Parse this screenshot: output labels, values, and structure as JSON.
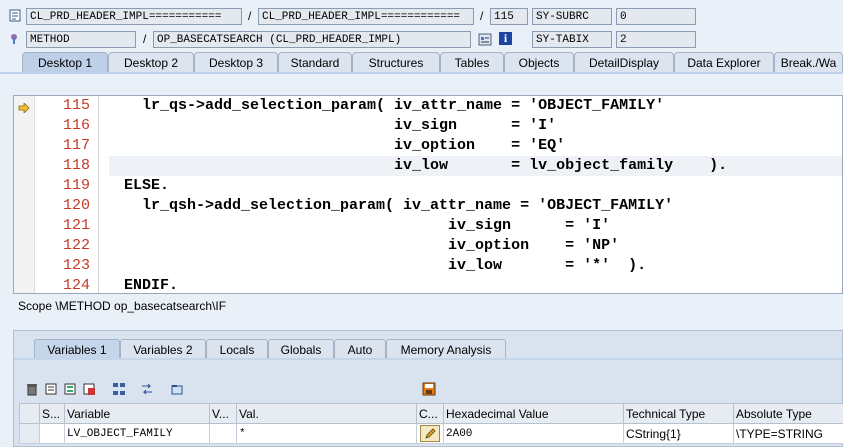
{
  "header": {
    "row1": {
      "program": "CL_PRD_HEADER_IMPL===========",
      "include": "CL_PRD_HEADER_IMPL============",
      "line": "115",
      "sysfield_name": "SY-SUBRC",
      "sysfield_value": "0"
    },
    "row2": {
      "event_type": "METHOD",
      "event": "OP_BASECATSEARCH (CL_PRD_HEADER_IMPL)",
      "sysfield_name": "SY-TABIX",
      "sysfield_value": "2"
    },
    "separator": "/"
  },
  "desktop_tabs": [
    {
      "label": "Desktop 1"
    },
    {
      "label": "Desktop 2"
    },
    {
      "label": "Desktop 3"
    },
    {
      "label": "Standard"
    },
    {
      "label": "Structures"
    },
    {
      "label": "Tables"
    },
    {
      "label": "Objects"
    },
    {
      "label": "DetailDisplay"
    },
    {
      "label": "Data Explorer"
    },
    {
      "label": "Break./Wa"
    }
  ],
  "code": {
    "current_line": "115",
    "lines": [
      {
        "num": "115",
        "text": "  lr_qs->add_selection_param( iv_attr_name = 'OBJECT_FAMILY'"
      },
      {
        "num": "116",
        "text": "                              iv_sign      = 'I'"
      },
      {
        "num": "117",
        "text": "                              iv_option    = 'EQ'"
      },
      {
        "num": "118",
        "text": "                              iv_low       = lv_object_family    )."
      },
      {
        "num": "119",
        "text": "ELSE."
      },
      {
        "num": "120",
        "text": "  lr_qsh->add_selection_param( iv_attr_name = 'OBJECT_FAMILY'"
      },
      {
        "num": "121",
        "text": "                                    iv_sign      = 'I'"
      },
      {
        "num": "122",
        "text": "                                    iv_option    = 'NP'"
      },
      {
        "num": "123",
        "text": "                                    iv_low       = '*'  )."
      },
      {
        "num": "124",
        "text": "ENDIF."
      }
    ]
  },
  "scope": "Scope \\METHOD op_basecatsearch\\IF",
  "variable_tabs": [
    {
      "label": "Variables 1"
    },
    {
      "label": "Variables 2"
    },
    {
      "label": "Locals"
    },
    {
      "label": "Globals"
    },
    {
      "label": "Auto"
    },
    {
      "label": "Memory Analysis"
    }
  ],
  "variables_table": {
    "columns": [
      "S...",
      "Variable",
      "V...",
      "Val.",
      "C...",
      "Hexadecimal Value",
      "Technical Type",
      "Absolute Type"
    ],
    "rows": [
      {
        "variable": "LV_OBJECT_FAMILY",
        "value": "*",
        "hex": "2A00",
        "technical_type": "CString{1}",
        "absolute_type": "\\TYPE=STRING"
      }
    ]
  },
  "icons": {
    "program": "program-icon",
    "method": "method-icon",
    "info": "info-icon",
    "current_line_arrow": "arrow-right-icon"
  },
  "colors": {
    "line_number": "#c43a2a",
    "string_literal": "#3a4fb5",
    "active_tab": "#bdd0e8"
  }
}
